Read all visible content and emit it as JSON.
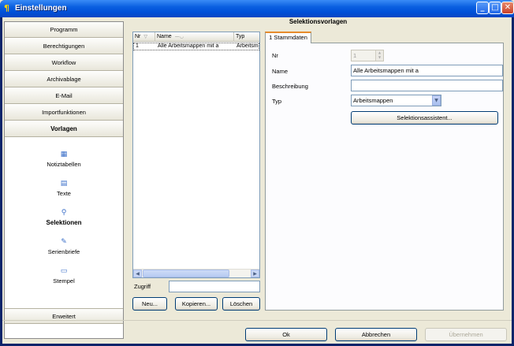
{
  "window": {
    "title": "Einstellungen"
  },
  "nav": {
    "top_buttons": [
      {
        "label": "Programm"
      },
      {
        "label": "Berechtigungen"
      },
      {
        "label": "Workflow"
      },
      {
        "label": "Archivablage"
      },
      {
        "label": "E-Mail"
      },
      {
        "label": "Importfunktionen"
      },
      {
        "label": "Vorlagen"
      }
    ],
    "items": [
      {
        "label": "Notiztabellen",
        "icon": "table-icon"
      },
      {
        "label": "Texte",
        "icon": "text-icon"
      },
      {
        "label": "Selektionen",
        "icon": "magnifier-icon"
      },
      {
        "label": "Serienbriefe",
        "icon": "pencil-icon"
      },
      {
        "label": "Stempel",
        "icon": "stamp-icon"
      }
    ],
    "bottom_button": "Erweitert"
  },
  "main": {
    "header": "Selektionsvorlagen",
    "grid": {
      "columns": [
        "Nr",
        "Name",
        "Typ"
      ],
      "rows": [
        {
          "nr": "1",
          "name": "Alle Arbeitsmappen mit a",
          "typ": "Arbeitsma"
        }
      ]
    },
    "zugriff_label": "Zugriff",
    "zugriff_value": "",
    "buttons": {
      "new": "Neu...",
      "copy": "Kopieren...",
      "delete": "Löschen"
    },
    "tab_label": "1 Stammdaten",
    "form": {
      "nr_label": "Nr",
      "nr_value": "1",
      "name_label": "Name",
      "name_value": "Alle Arbeitsmappen mit a",
      "beschreibung_label": "Beschreibung",
      "beschreibung_value": "",
      "typ_label": "Typ",
      "typ_value": "Arbeitsmappen",
      "assistant_button": "Selektionsassistent..."
    }
  },
  "footer": {
    "ok": "Ok",
    "cancel": "Abbrechen",
    "apply": "Übernehmen"
  }
}
